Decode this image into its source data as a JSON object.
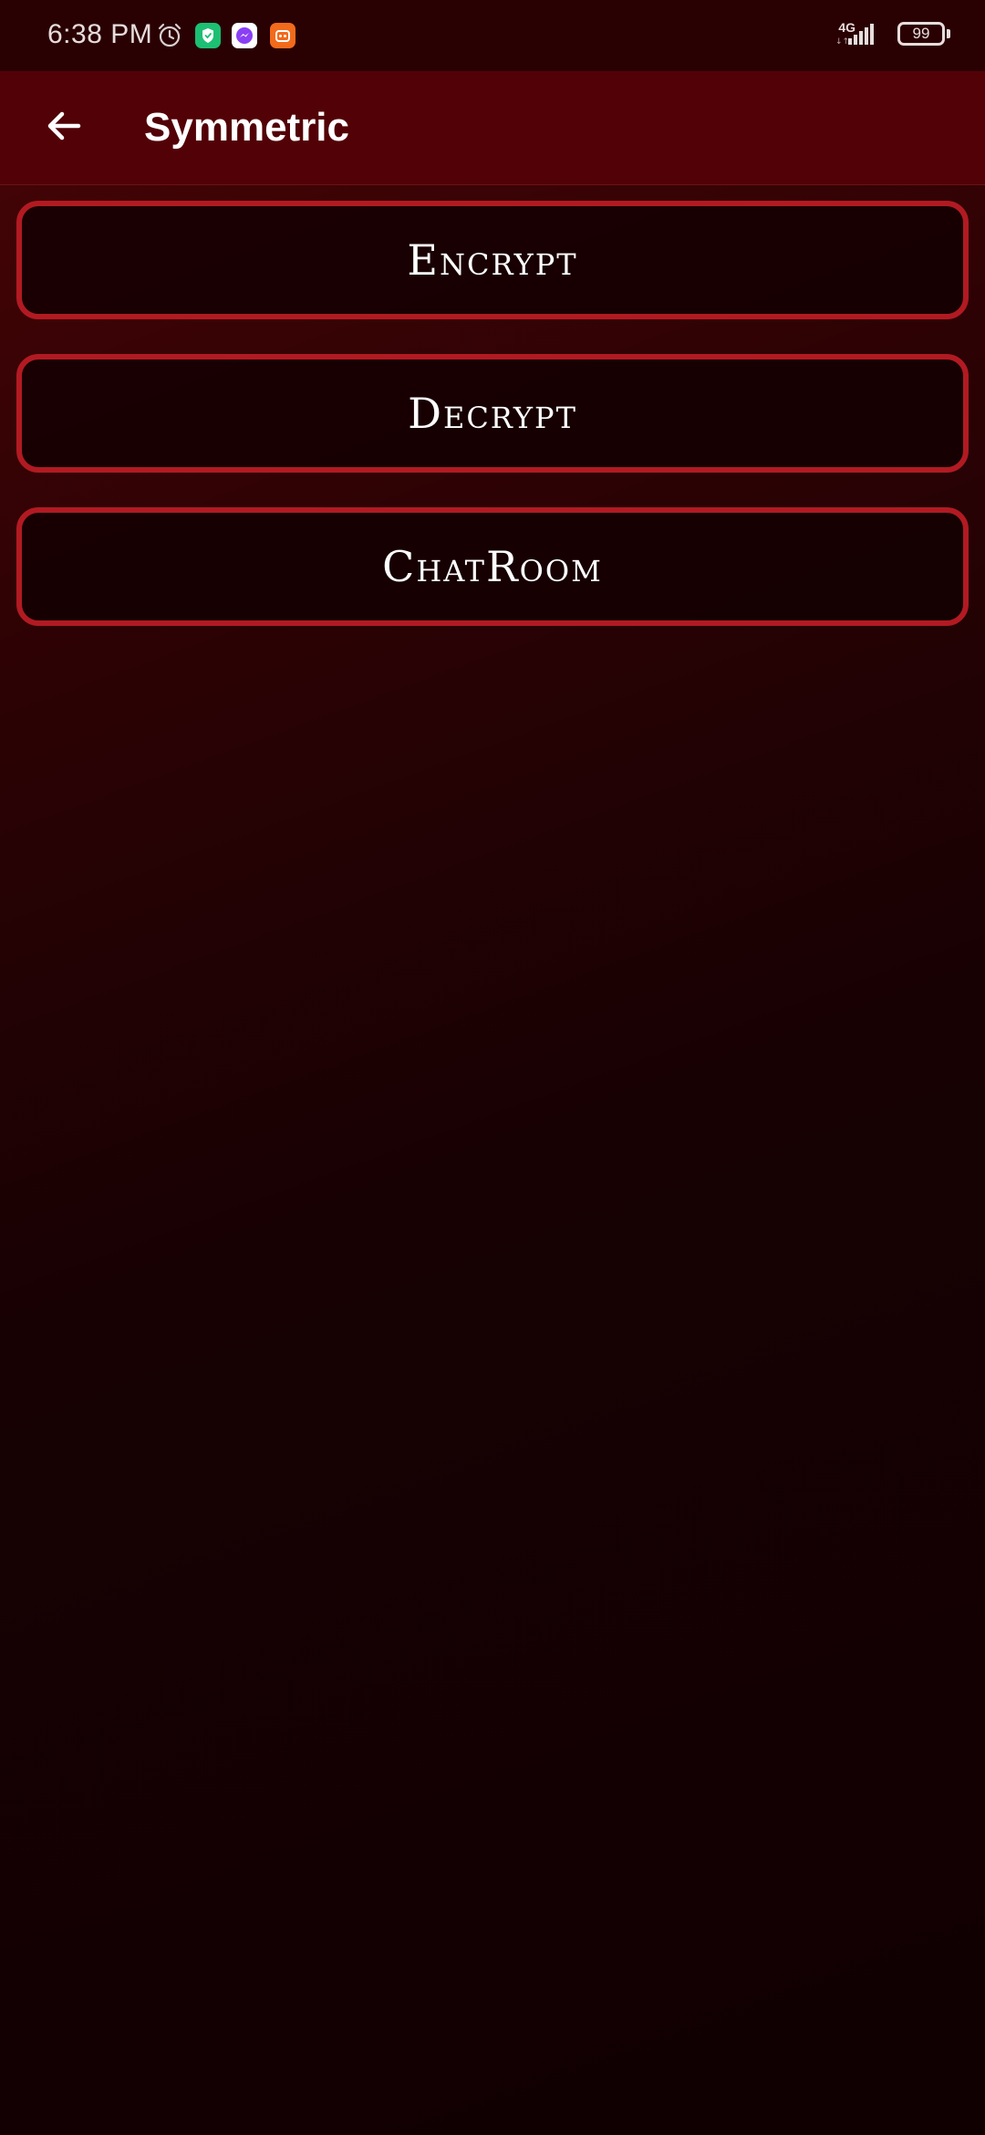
{
  "status_bar": {
    "time": "6:38 PM",
    "network": "4G",
    "battery": "99",
    "notification_icons": [
      "alarm-icon",
      "shield-app-icon",
      "messenger-icon",
      "orange-app-icon"
    ],
    "colors": {
      "shield_app": "#1dbf73",
      "messenger": "#ffffff",
      "orange_app": "#f26a1b"
    }
  },
  "app_bar": {
    "back_icon": "arrow-left-icon",
    "title": "Symmetric"
  },
  "menu": {
    "items": [
      {
        "label": "Encrypt"
      },
      {
        "label": "Decrypt"
      },
      {
        "label": "ChatRoom"
      }
    ]
  },
  "theme": {
    "appbar_bg": "#520206",
    "button_border": "#b21a22",
    "background_dark": "#100002"
  }
}
